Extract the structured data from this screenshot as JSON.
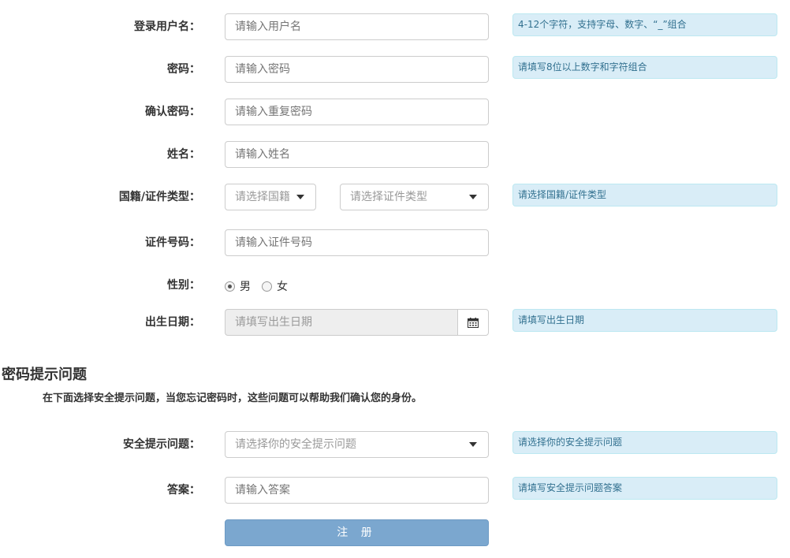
{
  "form": {
    "username": {
      "label": "登录用户名：",
      "placeholder": "请输入用户名",
      "hint": "4-12个字符，支持字母、数字、“_”组合"
    },
    "password": {
      "label": "密码：",
      "placeholder": "请输入密码",
      "hint": "请填写8位以上数字和字符组合"
    },
    "confirm_password": {
      "label": "确认密码：",
      "placeholder": "请输入重复密码"
    },
    "name": {
      "label": "姓名：",
      "placeholder": "请输入姓名"
    },
    "nationality_id_type": {
      "label": "国籍/证件类型：",
      "nationality_selected": "请选择国籍",
      "id_type_selected": "请选择证件类型",
      "hint": "请选择国籍/证件类型"
    },
    "id_number": {
      "label": "证件号码：",
      "placeholder": "请输入证件号码"
    },
    "gender": {
      "label": "性别：",
      "options": [
        "男",
        "女"
      ],
      "selected": "男"
    },
    "birthday": {
      "label": "出生日期：",
      "placeholder": "请填写出生日期",
      "hint": "请填写出生日期",
      "icon": "calendar-icon"
    }
  },
  "security_section": {
    "title": "密码提示问题",
    "description": "在下面选择安全提示问题，当您忘记密码时，这些问题可以帮助我们确认您的身份。",
    "question": {
      "label": "安全提示问题：",
      "selected": "请选择你的安全提示问题",
      "hint": "请选择你的安全提示问题"
    },
    "answer": {
      "label": "答案：",
      "placeholder": "请输入答案",
      "hint": "请填写安全提示问题答案"
    }
  },
  "submit_label": "注 册",
  "colors": {
    "hint_bg": "#d9edf7",
    "hint_text": "#31708f",
    "button_bg": "#7ba7cf"
  }
}
